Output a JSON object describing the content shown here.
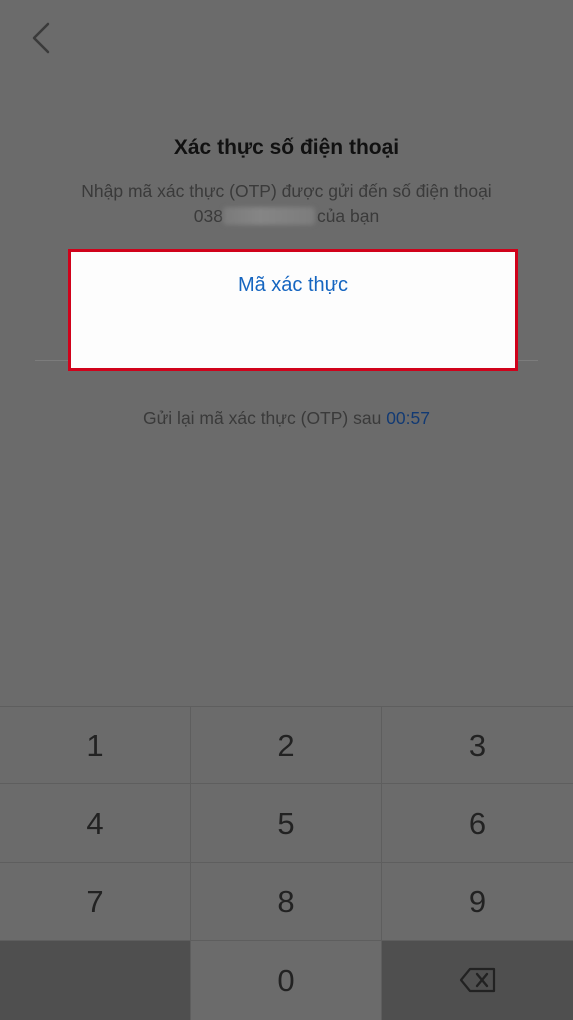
{
  "header": {
    "back_icon": "chevron-left-icon"
  },
  "title": "Xác thực số điện thoại",
  "subtitle": {
    "line1": "Nhập mã xác thực (OTP) được gửi đến số điện thoại",
    "phone_prefix": "038",
    "line2_suffix": "của bạn"
  },
  "otp": {
    "placeholder": "Mã xác thực",
    "value": ""
  },
  "resend": {
    "text": "Gửi lại mã xác thực (OTP) sau",
    "timer": "00:57"
  },
  "keypad": {
    "keys": [
      "1",
      "2",
      "3",
      "4",
      "5",
      "6",
      "7",
      "8",
      "9",
      "",
      "0"
    ],
    "backspace_icon": "backspace-icon"
  },
  "colors": {
    "overlay_bg": "#6b6b6b",
    "highlight_border": "#d0021b",
    "accent_blue": "#1565c0"
  }
}
